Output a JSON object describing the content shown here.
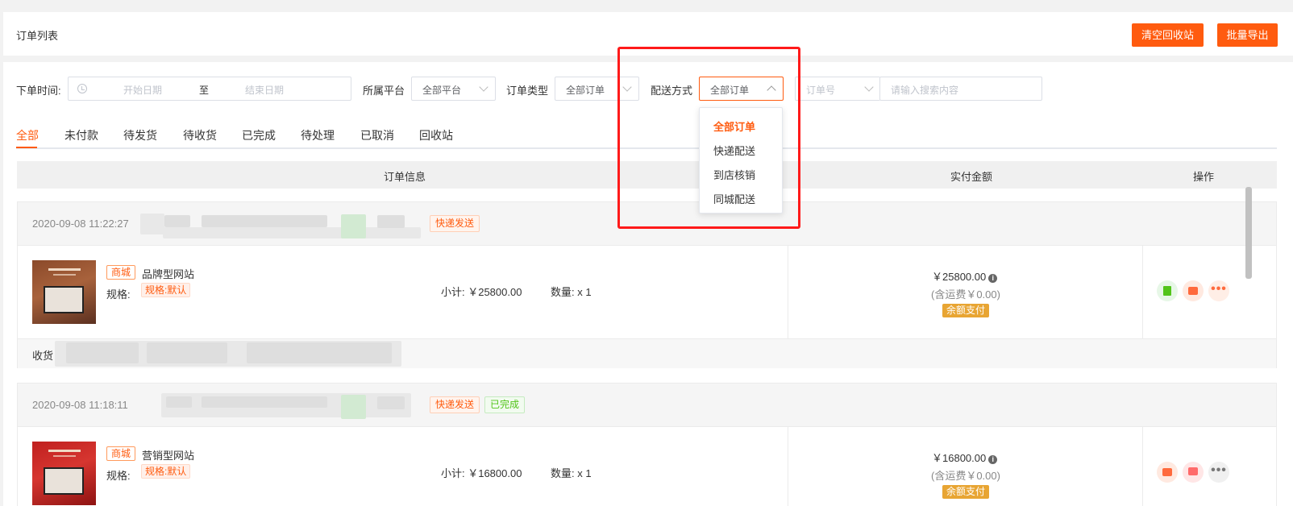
{
  "header": {
    "title": "订单列表",
    "clear_recycle_label": "清空回收站",
    "batch_export_label": "批量导出"
  },
  "filters": {
    "order_time_label": "下单时间:",
    "start_date_placeholder": "开始日期",
    "to_label": "至",
    "end_date_placeholder": "结束日期",
    "platform_label": "所属平台",
    "platform_value": "全部平台",
    "order_type_label": "订单类型",
    "order_type_value": "全部订单",
    "delivery_label": "配送方式",
    "delivery_value": "全部订单",
    "search_field_value": "订单号",
    "search_placeholder": "请输入搜索内容"
  },
  "delivery_dropdown": {
    "options": [
      "全部订单",
      "快递配送",
      "到店核销",
      "同城配送"
    ],
    "selected": "全部订单"
  },
  "tabs": [
    "全部",
    "未付款",
    "待发货",
    "待收货",
    "已完成",
    "待处理",
    "已取消",
    "回收站"
  ],
  "active_tab": "全部",
  "table_header": {
    "order_info": "订单信息",
    "paid_amount": "实付金额",
    "actions": "操作"
  },
  "orders": [
    {
      "time": "2020-09-08 11:22:27",
      "tags": [
        "快递发送"
      ],
      "shop_tag": "商城",
      "product_name": "品牌型网站",
      "spec_label": "规格:",
      "spec_value": "规格:默认",
      "subtotal": "小计: ￥25800.00",
      "quantity": "数量: x 1",
      "amount": "￥25800.00",
      "freight": "(含运费￥0.00)",
      "pay_method": "余额支付",
      "receiver_label": "收货"
    },
    {
      "time": "2020-09-08 11:18:11",
      "tags": [
        "快递发送",
        "已完成"
      ],
      "shop_tag": "商城",
      "product_name": "营销型网站",
      "spec_label": "规格:",
      "spec_value": "规格:默认",
      "subtotal": "小计: ￥16800.00",
      "quantity": "数量: x 1",
      "amount": "￥16800.00",
      "freight": "(含运费￥0.00)",
      "pay_method": "余额支付"
    }
  ],
  "colors": {
    "accent": "#ff5b0f",
    "highlight": "#ff1a1a",
    "success": "#52c41a",
    "pay_tag": "#e8a533"
  },
  "icons": [
    "clock-icon",
    "chevron-down-icon",
    "chevron-up-icon",
    "info-icon",
    "clipboard-check-icon",
    "printer-icon",
    "chat-icon",
    "more-icon"
  ]
}
